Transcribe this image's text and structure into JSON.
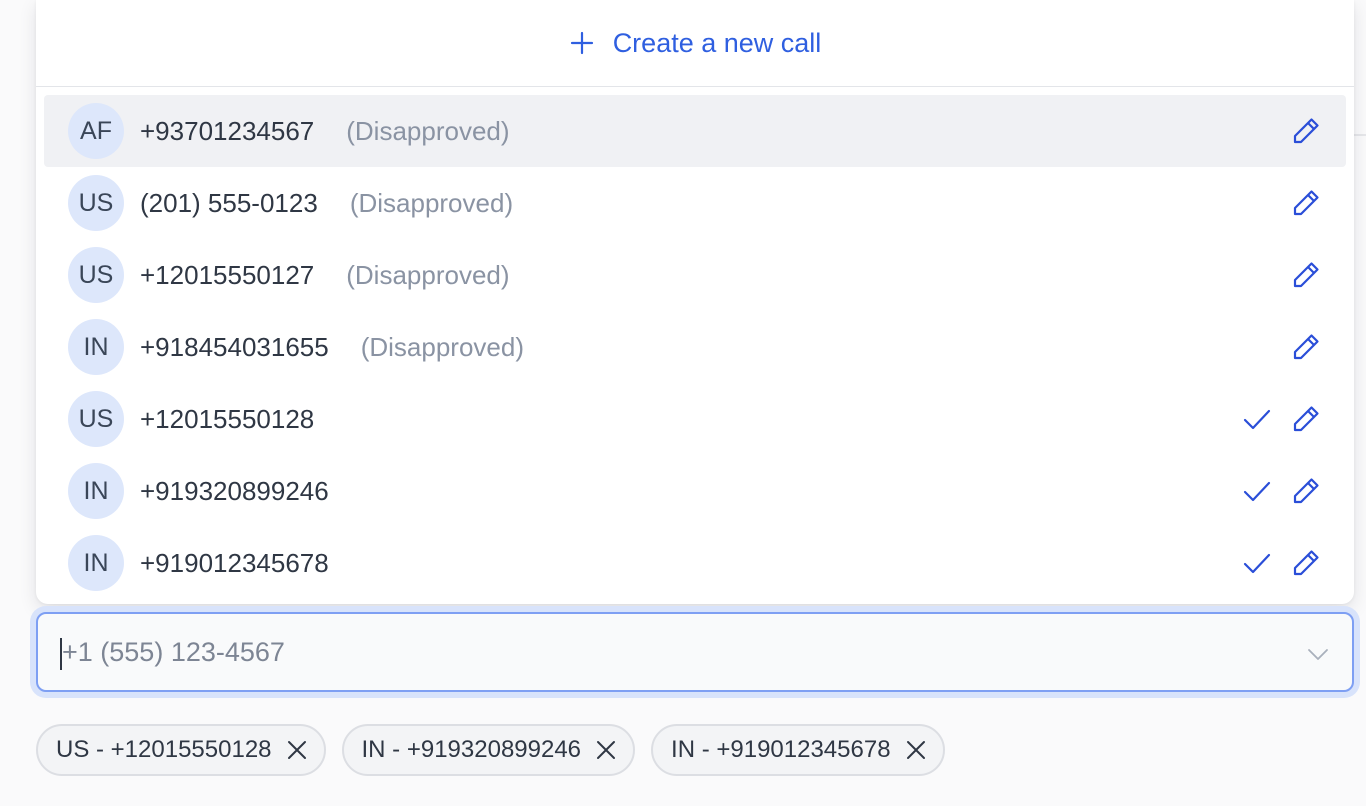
{
  "create_new": {
    "label": "Create a new call",
    "icon": "plus-icon"
  },
  "options": [
    {
      "country": "AF",
      "phone": "+93701234567",
      "status": "(Disapproved)",
      "selected": false
    },
    {
      "country": "US",
      "phone": "(201) 555-0123",
      "status": "(Disapproved)",
      "selected": false
    },
    {
      "country": "US",
      "phone": "+12015550127",
      "status": "(Disapproved)",
      "selected": false
    },
    {
      "country": "IN",
      "phone": "+918454031655",
      "status": "(Disapproved)",
      "selected": false
    },
    {
      "country": "US",
      "phone": "+12015550128",
      "status": "",
      "selected": true
    },
    {
      "country": "IN",
      "phone": "+919320899246",
      "status": "",
      "selected": true
    },
    {
      "country": "IN",
      "phone": "+919012345678",
      "status": "",
      "selected": true
    }
  ],
  "phone_input": {
    "placeholder": "+1 (555) 123-4567",
    "value": ""
  },
  "selected_chips": [
    {
      "label": "US - +12015550128"
    },
    {
      "label": "IN - +919320899246"
    },
    {
      "label": "IN - +919012345678"
    }
  ],
  "colors": {
    "accent": "#2f5fe0",
    "avatar_bg": "#dde7fb",
    "status_text": "#8a93a3",
    "focus_ring": "#7e9ff3"
  }
}
